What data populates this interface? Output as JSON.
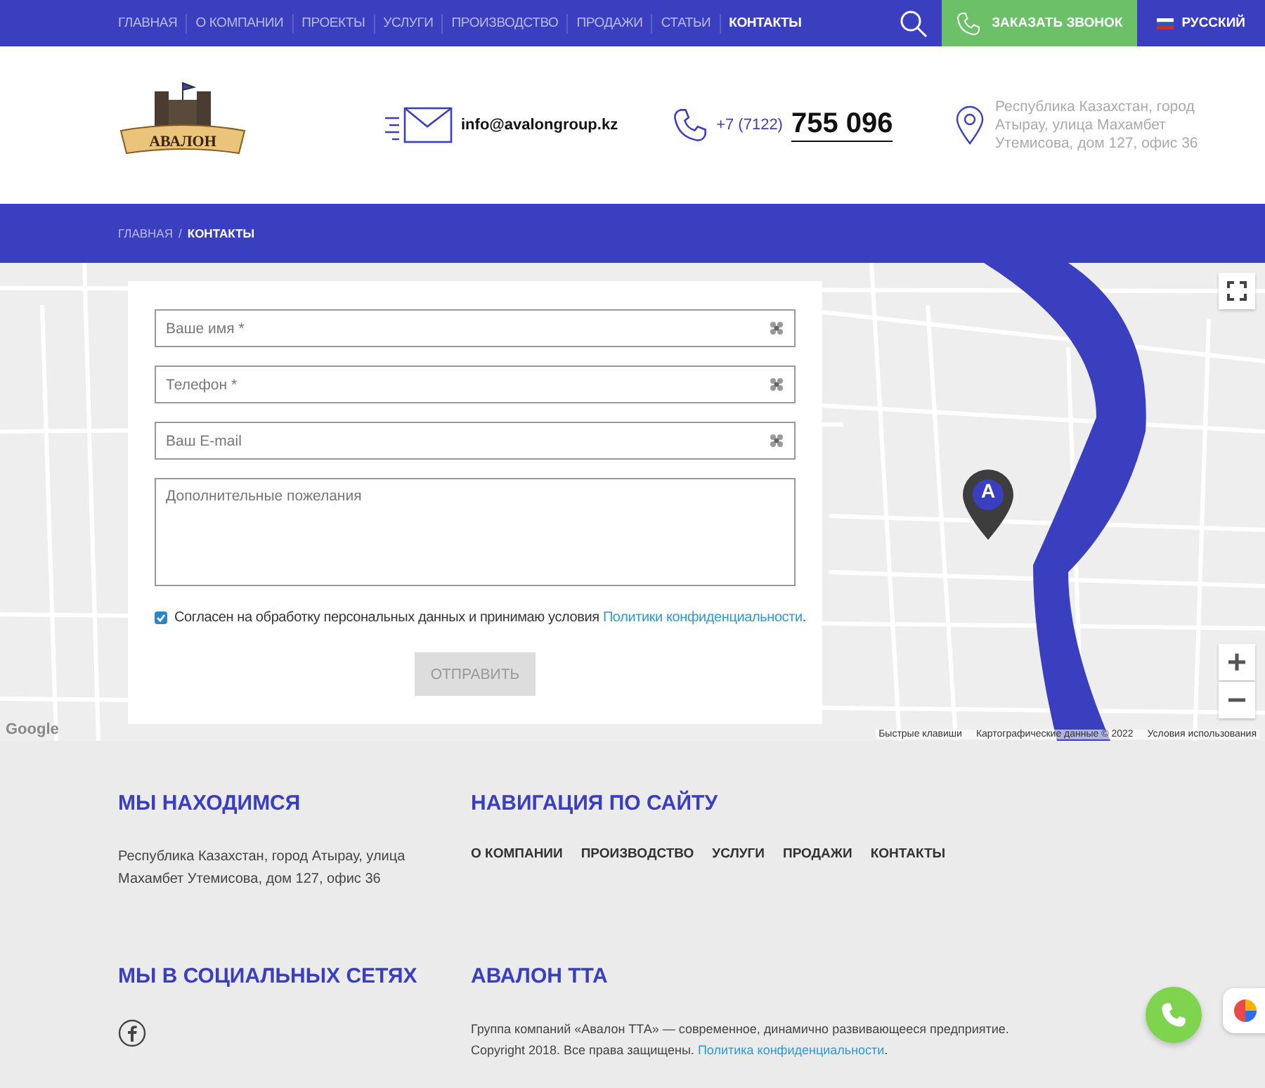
{
  "top_nav": {
    "items": [
      {
        "label": "ГЛАВНАЯ",
        "selected": false
      },
      {
        "label": "О КОМПАНИИ",
        "selected": false
      },
      {
        "label": "ПРОЕКТЫ",
        "selected": false
      },
      {
        "label": "УСЛУГИ",
        "selected": false
      },
      {
        "label": "ПРОИЗВОДСТВО",
        "selected": false
      },
      {
        "label": "ПРОДАЖИ",
        "selected": false
      },
      {
        "label": "СТАТЬИ",
        "selected": false
      },
      {
        "label": "КОНТАКТЫ",
        "selected": true
      }
    ],
    "callback_button": "ЗАКАЗАТЬ ЗВОНОК",
    "language": "РУССКИЙ"
  },
  "header": {
    "logo_text": "АВАЛОН",
    "email": "info@avalongroup.kz",
    "phone_prefix": "+7 (7122)",
    "phone_number": "755 096",
    "address": "Республика Казахстан, город Атырау, улица Махамбет Утемисова, дом 127, офис 36"
  },
  "breadcrumb": [
    {
      "label": "ГЛАВНАЯ",
      "selected": false
    },
    {
      "label": "КОНТАКТЫ",
      "selected": true
    }
  ],
  "breadcrumb_separator": "/",
  "form": {
    "fields": [
      {
        "kind": "input",
        "placeholder": "Ваше имя *"
      },
      {
        "kind": "input",
        "placeholder": "Телефон *"
      },
      {
        "kind": "input",
        "placeholder": "Ваш E-mail"
      },
      {
        "kind": "textarea",
        "placeholder": "Дополнительные пожелания"
      }
    ],
    "consent": {
      "checked": true,
      "text": "Согласен на обработку персональных данных и принимаю условия ",
      "link": "Политики конфиденциальности",
      "end": "."
    },
    "submit": "ОТПРАВИТЬ"
  },
  "map": {
    "marker_label": "A",
    "logo": "Google",
    "attribution": [
      "Быстрые клавиши",
      "Картографические данные © 2022",
      "Условия использования"
    ]
  },
  "footer": {
    "location": {
      "title": "МЫ НАХОДИМСЯ",
      "address": "Республика Казахстан, город Атырау, улица Махамбет Утемисова, дом 127, офис 36"
    },
    "navigation": {
      "title": "НАВИГАЦИЯ ПО САЙТУ",
      "links": [
        "О КОМПАНИИ",
        "ПРОИЗВОДСТВО",
        "УСЛУГИ",
        "ПРОДАЖИ",
        "КОНТАКТЫ"
      ]
    },
    "social": {
      "title": "МЫ В СОЦИАЛЬНЫХ СЕТЯХ"
    },
    "about": {
      "title": "АВАЛОН ТТА",
      "description": "Группа компаний «Авалон ТТА» — современное, динамично развивающееся предприятие.",
      "copyright": "Copyright 2018. Все права защищены. ",
      "link": "Политика конфиденциальности",
      "end": "."
    }
  }
}
